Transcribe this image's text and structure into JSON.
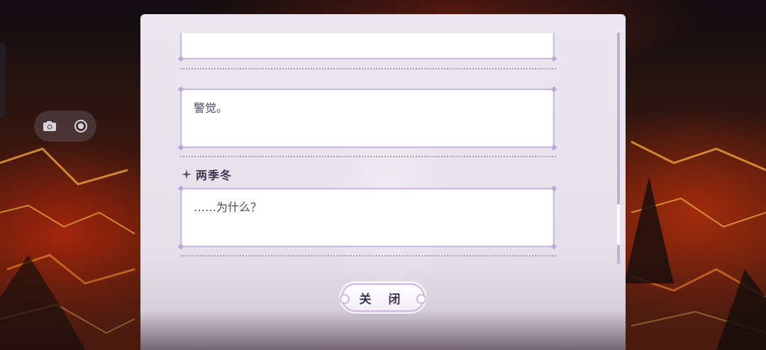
{
  "background": {
    "scene": "volcanic-lava-field",
    "colors": {
      "lava": "#e8421c",
      "glow": "#f2a23a",
      "rock": "#2a1410"
    }
  },
  "toolbar": {
    "camera_icon": "camera-icon",
    "record_icon": "record-icon"
  },
  "dialog_log": {
    "entries": [
      {
        "speaker": "",
        "text": ""
      },
      {
        "speaker": "",
        "text": "警觉。"
      },
      {
        "speaker": "两季冬",
        "text": "……为什么？"
      }
    ],
    "speaker_marker_icon": "sparkle-star-icon",
    "close_label": "关 闭"
  },
  "colors": {
    "panel_bg": "#ece6ee",
    "box_border": "#cbbde0",
    "text": "#4e4660",
    "scrollbar": "#b9b3cf"
  }
}
